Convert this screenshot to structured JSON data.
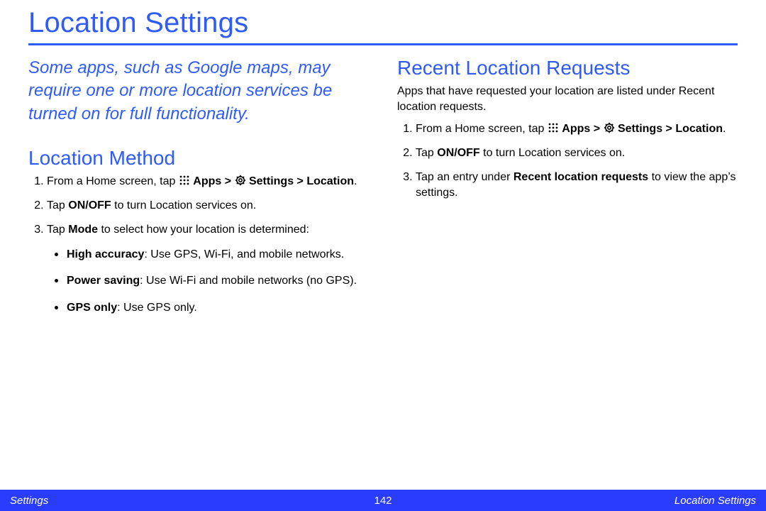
{
  "page": {
    "title": "Location Settings"
  },
  "left": {
    "intro": "Some apps, such as Google maps, may require one or more location services be turned on for full functionality.",
    "section_title": "Location Method",
    "step1_prefix": "From a Home screen, tap ",
    "step1_apps": " Apps > ",
    "step1_settings": " Settings > Location",
    "step1_suffix": ".",
    "step2_a": "Tap ",
    "step2_b": "ON/OFF",
    "step2_c": " to turn Location services on.",
    "step3_a": "Tap ",
    "step3_b": "Mode",
    "step3_c": " to select how your location is determined:",
    "bullet1_b": "High accuracy",
    "bullet1_t": ": Use GPS, Wi-Fi, and mobile networks.",
    "bullet2_b": "Power saving",
    "bullet2_t": ": Use Wi-Fi and mobile networks (no GPS).",
    "bullet3_b": "GPS only",
    "bullet3_t": ": Use GPS only."
  },
  "right": {
    "section_title": "Recent Location Requests",
    "lead": "Apps that have requested your location are listed under Recent location requests.",
    "step1_prefix": "From a Home screen, tap ",
    "step1_apps": " Apps > ",
    "step1_settings": " Settings > Location",
    "step1_suffix": ".",
    "step2_a": "Tap ",
    "step2_b": "ON/OFF",
    "step2_c": " to turn Location services on.",
    "step3_a": "Tap an entry under ",
    "step3_b": "Recent location requests",
    "step3_c": " to view the app’s settings."
  },
  "footer": {
    "left": "Settings",
    "page_number": "142",
    "right": "Location Settings"
  }
}
